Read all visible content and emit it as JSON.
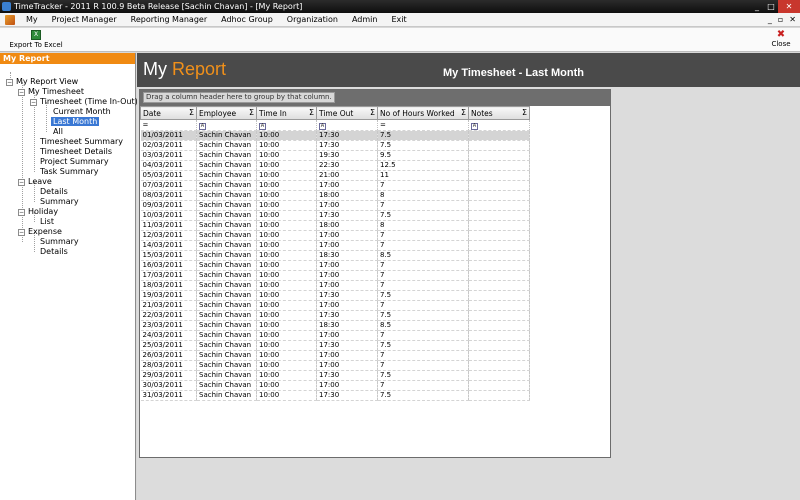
{
  "window": {
    "title": "TimeTracker - 2011 R 100.9 Beta Release  [Sachin Chavan] - [My Report]"
  },
  "menu": {
    "items": [
      "My",
      "Project Manager",
      "Reporting Manager",
      "Adhoc Group",
      "Organization",
      "Admin",
      "Exit"
    ]
  },
  "toolbar": {
    "export_label": "Export To Excel",
    "close_label": "Close"
  },
  "left_panel": {
    "header": "My Report",
    "tree": {
      "root": "My Report View",
      "my_timesheet": "My Timesheet",
      "timesheet_time_in_out": "Timesheet (Time In-Out)",
      "current_month": "Current Month",
      "last_month": "Last Month",
      "all": "All",
      "timesheet_summary": "Timesheet Summary",
      "timesheet_details": "Timesheet Details",
      "project_summary": "Project Summary",
      "task_summary": "Task Summary",
      "leave": "Leave",
      "leave_details": "Details",
      "leave_summary": "Summary",
      "holiday": "Holiday",
      "holiday_list": "List",
      "expense": "Expense",
      "expense_summary": "Summary",
      "expense_details": "Details"
    }
  },
  "report": {
    "title_main": "My",
    "title_accent": "Report",
    "subtitle": "My Timesheet - Last Month",
    "group_hint": "Drag a column header here to group by that column.",
    "columns": [
      "Date",
      "Employee",
      "Time In",
      "Time Out",
      "No of Hours Worked",
      "Notes"
    ],
    "rows": [
      [
        "01/03/2011",
        "Sachin Chavan",
        "10:00",
        "17:30",
        "7.5",
        ""
      ],
      [
        "02/03/2011",
        "Sachin Chavan",
        "10:00",
        "17:30",
        "7.5",
        ""
      ],
      [
        "03/03/2011",
        "Sachin Chavan",
        "10:00",
        "19:30",
        "9.5",
        ""
      ],
      [
        "04/03/2011",
        "Sachin Chavan",
        "10:00",
        "22:30",
        "12.5",
        ""
      ],
      [
        "05/03/2011",
        "Sachin Chavan",
        "10:00",
        "21:00",
        "11",
        ""
      ],
      [
        "07/03/2011",
        "Sachin Chavan",
        "10:00",
        "17:00",
        "7",
        ""
      ],
      [
        "08/03/2011",
        "Sachin Chavan",
        "10:00",
        "18:00",
        "8",
        ""
      ],
      [
        "09/03/2011",
        "Sachin Chavan",
        "10:00",
        "17:00",
        "7",
        ""
      ],
      [
        "10/03/2011",
        "Sachin Chavan",
        "10:00",
        "17:30",
        "7.5",
        ""
      ],
      [
        "11/03/2011",
        "Sachin Chavan",
        "10:00",
        "18:00",
        "8",
        ""
      ],
      [
        "12/03/2011",
        "Sachin Chavan",
        "10:00",
        "17:00",
        "7",
        ""
      ],
      [
        "14/03/2011",
        "Sachin Chavan",
        "10:00",
        "17:00",
        "7",
        ""
      ],
      [
        "15/03/2011",
        "Sachin Chavan",
        "10:00",
        "18:30",
        "8.5",
        ""
      ],
      [
        "16/03/2011",
        "Sachin Chavan",
        "10:00",
        "17:00",
        "7",
        ""
      ],
      [
        "17/03/2011",
        "Sachin Chavan",
        "10:00",
        "17:00",
        "7",
        ""
      ],
      [
        "18/03/2011",
        "Sachin Chavan",
        "10:00",
        "17:00",
        "7",
        ""
      ],
      [
        "19/03/2011",
        "Sachin Chavan",
        "10:00",
        "17:30",
        "7.5",
        ""
      ],
      [
        "21/03/2011",
        "Sachin Chavan",
        "10:00",
        "17:00",
        "7",
        ""
      ],
      [
        "22/03/2011",
        "Sachin Chavan",
        "10:00",
        "17:30",
        "7.5",
        ""
      ],
      [
        "23/03/2011",
        "Sachin Chavan",
        "10:00",
        "18:30",
        "8.5",
        ""
      ],
      [
        "24/03/2011",
        "Sachin Chavan",
        "10:00",
        "17:00",
        "7",
        ""
      ],
      [
        "25/03/2011",
        "Sachin Chavan",
        "10:00",
        "17:30",
        "7.5",
        ""
      ],
      [
        "26/03/2011",
        "Sachin Chavan",
        "10:00",
        "17:00",
        "7",
        ""
      ],
      [
        "28/03/2011",
        "Sachin Chavan",
        "10:00",
        "17:00",
        "7",
        ""
      ],
      [
        "29/03/2011",
        "Sachin Chavan",
        "10:00",
        "17:30",
        "7.5",
        ""
      ],
      [
        "30/03/2011",
        "Sachin Chavan",
        "10:00",
        "17:00",
        "7",
        ""
      ],
      [
        "31/03/2011",
        "Sachin Chavan",
        "10:00",
        "17:30",
        "7.5",
        ""
      ]
    ]
  }
}
